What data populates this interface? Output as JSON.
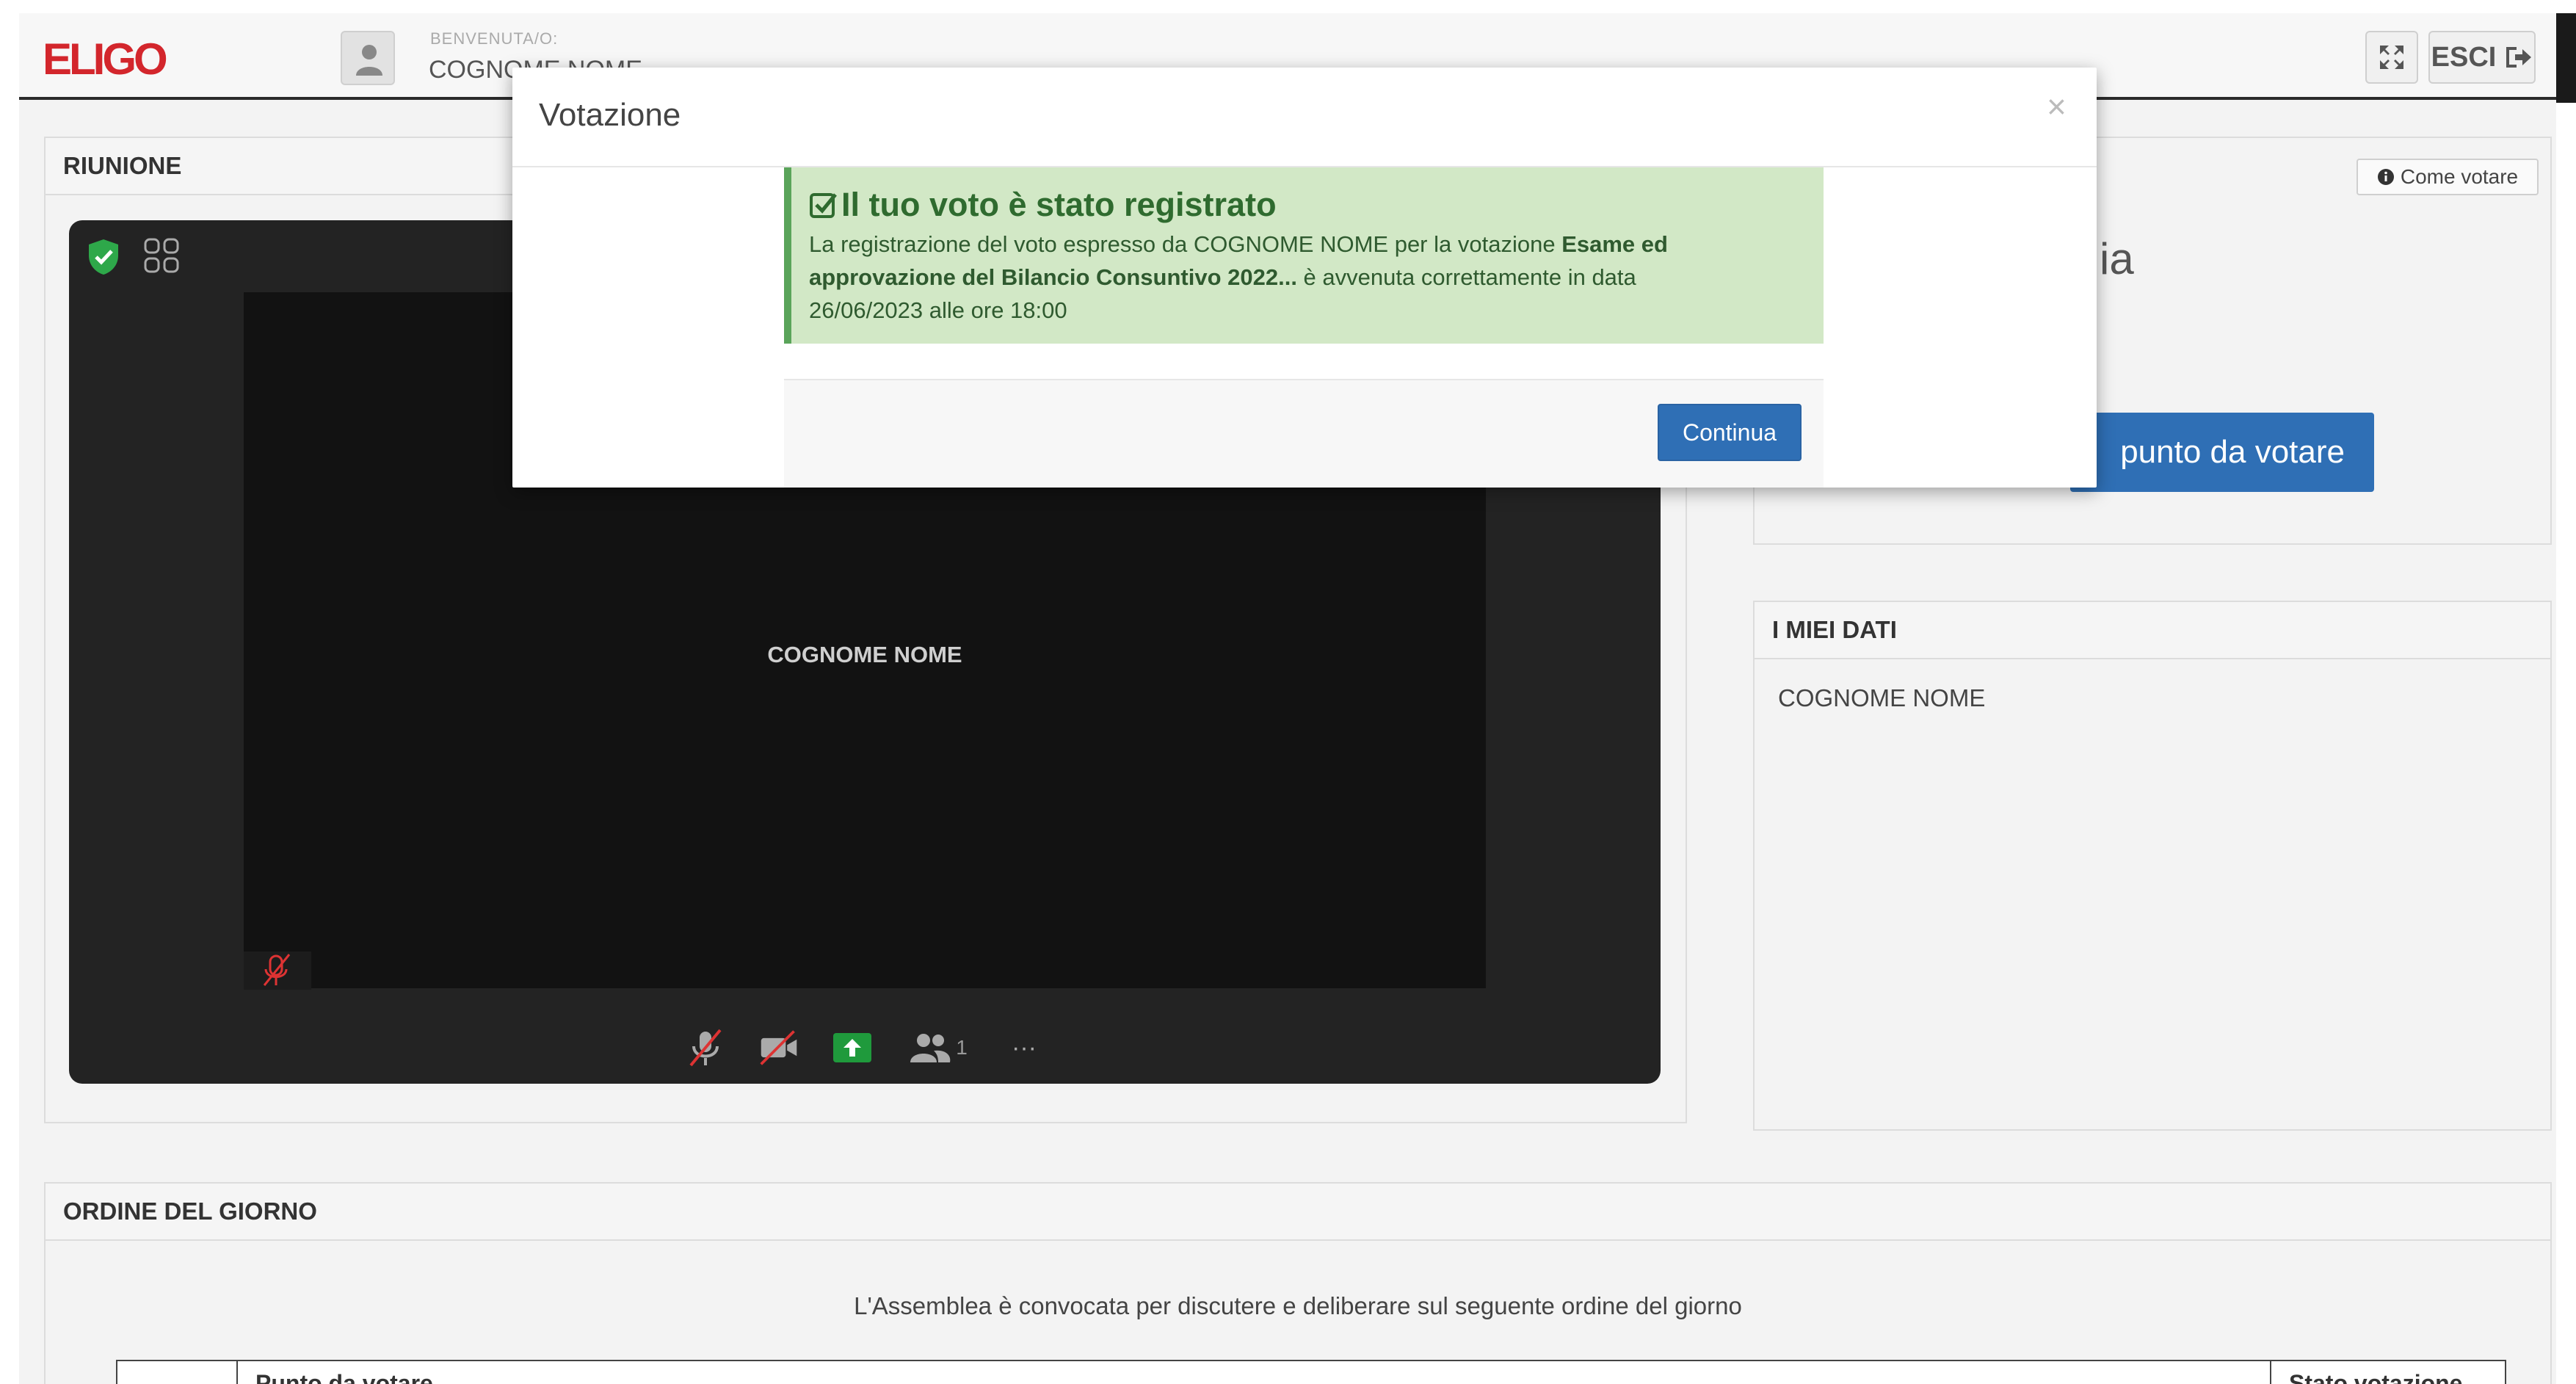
{
  "app": {
    "logo": "ELIGO",
    "welcome_label": "BENVENUTA/O:",
    "welcome_name": "COGNOME NOME",
    "esci_label": "ESCI"
  },
  "riunione": {
    "title": "RIUNIONE",
    "participant_name": "COGNOME NOME",
    "participants_count": "1",
    "more_label": "···"
  },
  "votare": {
    "partial_heading": "ia",
    "button_label": "punto da votare",
    "come_votare_label": "Come votare"
  },
  "miei_dati": {
    "title": "I MIEI DATI",
    "name": "COGNOME NOME"
  },
  "ordine": {
    "title": "ORDINE DEL GIORNO",
    "description": "L'Assemblea è convocata per discutere e deliberare sul seguente ordine del giorno",
    "columns": [
      "",
      "Punto da votare",
      "Stato votazione"
    ]
  },
  "modal": {
    "title": "Votazione",
    "close_label": "×",
    "alert_title": "Il tuo voto è stato registrato",
    "alert_text_1": "La registrazione del voto espresso da COGNOME NOME per la votazione ",
    "alert_bold_1": "Esame ed",
    "alert_bold_2": "approvazione del Bilancio Consuntivo 2022...",
    "alert_text_2": " è avvenuta correttamente in data",
    "alert_text_3": "26/06/2023 alle ore 18:00",
    "continue_label": "Continua"
  },
  "colors": {
    "brand": "#d3262c",
    "primary": "#2f6fb5",
    "success_bg": "#d2e8c6",
    "success_text": "#2f6b2f"
  }
}
